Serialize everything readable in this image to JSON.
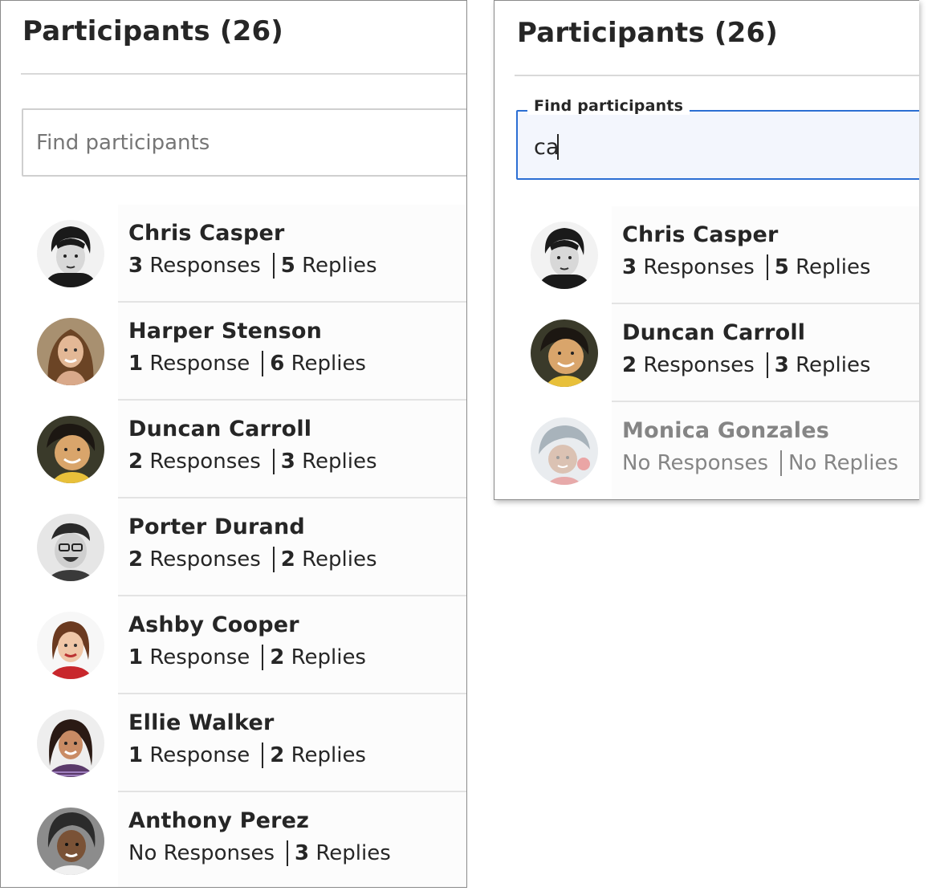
{
  "left_panel": {
    "title": "Participants (26)",
    "search": {
      "placeholder": "Find participants",
      "value": ""
    },
    "participants": [
      {
        "name": "Chris Casper",
        "responses_count": "3",
        "responses_label": "Responses",
        "replies_count": "5",
        "replies_label": "Replies"
      },
      {
        "name": "Harper Stenson",
        "responses_count": "1",
        "responses_label": "Response",
        "replies_count": "6",
        "replies_label": "Replies"
      },
      {
        "name": "Duncan Carroll",
        "responses_count": "2",
        "responses_label": "Responses",
        "replies_count": "3",
        "replies_label": "Replies"
      },
      {
        "name": "Porter Durand",
        "responses_count": "2",
        "responses_label": "Responses",
        "replies_count": "2",
        "replies_label": "Replies"
      },
      {
        "name": "Ashby Cooper",
        "responses_count": "1",
        "responses_label": "Response",
        "replies_count": "2",
        "replies_label": "Replies"
      },
      {
        "name": "Ellie Walker",
        "responses_count": "1",
        "responses_label": "Response",
        "replies_count": "2",
        "replies_label": "Replies"
      },
      {
        "name": "Anthony Perez",
        "responses_count": "",
        "responses_label": "No Responses",
        "replies_count": "3",
        "replies_label": "Replies"
      }
    ]
  },
  "right_panel": {
    "title": "Participants (26)",
    "search": {
      "label": "Find participants",
      "value": "ca"
    },
    "participants": [
      {
        "name": "Chris Casper",
        "responses_count": "3",
        "responses_label": "Responses",
        "replies_count": "5",
        "replies_label": "Replies"
      },
      {
        "name": "Duncan Carroll",
        "responses_count": "2",
        "responses_label": "Responses",
        "replies_count": "3",
        "replies_label": "Replies"
      },
      {
        "name": "Monica Gonzales",
        "responses_count": "",
        "responses_label": "No Responses",
        "replies_count": "",
        "replies_label": "No Replies",
        "dimmed": true
      }
    ]
  },
  "colors": {
    "focus_border": "#2c6fd3",
    "text_primary": "#262626",
    "text_dimmed": "#858585",
    "divider": "#d9d9d9"
  }
}
